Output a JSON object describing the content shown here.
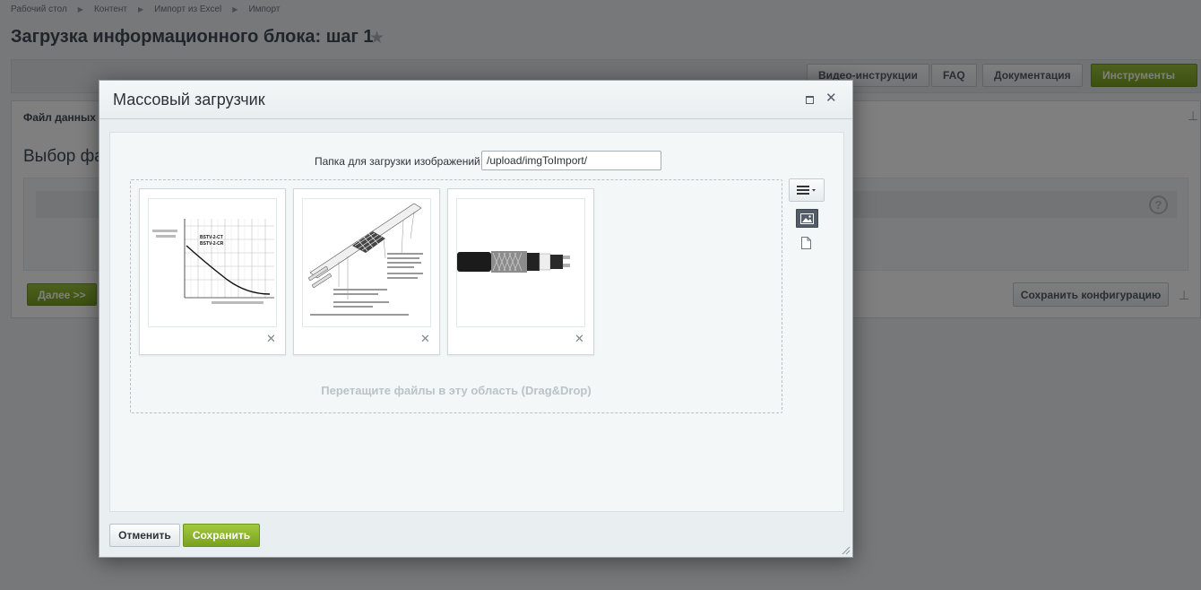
{
  "breadcrumb": [
    "Рабочий стол",
    "Контент",
    "Импорт из Excel",
    "Импорт"
  ],
  "page": {
    "title": "Загрузка информационного блока: шаг 1"
  },
  "toolbar": {
    "video_label": "Видео-инструкции",
    "faq_label": "FAQ",
    "docs_label": "Документация",
    "tools_label": "Инструменты"
  },
  "panel": {
    "tab_label": "Файл данных",
    "section_title": "Выбор файла",
    "next_label": "Далее >>",
    "save_config_label": "Сохранить конфигурацию"
  },
  "dialog": {
    "title": "Массовый загрузчик",
    "folder_label": "Папка для загрузки изображений:",
    "folder_value": "/upload/imgToImport/",
    "dropzone_hint": "Перетащите файлы в эту область (Drag&Drop)",
    "cancel_label": "Отменить",
    "save_label": "Сохранить",
    "thumbnails": [
      {
        "content": "chart-image",
        "chart_text": [
          "BSTV-2-CT",
          "BSTV-2-CR"
        ]
      },
      {
        "content": "cable-diagram-image"
      },
      {
        "content": "cable-photo-image"
      }
    ]
  },
  "colors": {
    "green_button": "#7aa11f",
    "overlay": "rgba(0,0,0,0.5)",
    "dialog_bg": "#e9eef0"
  }
}
